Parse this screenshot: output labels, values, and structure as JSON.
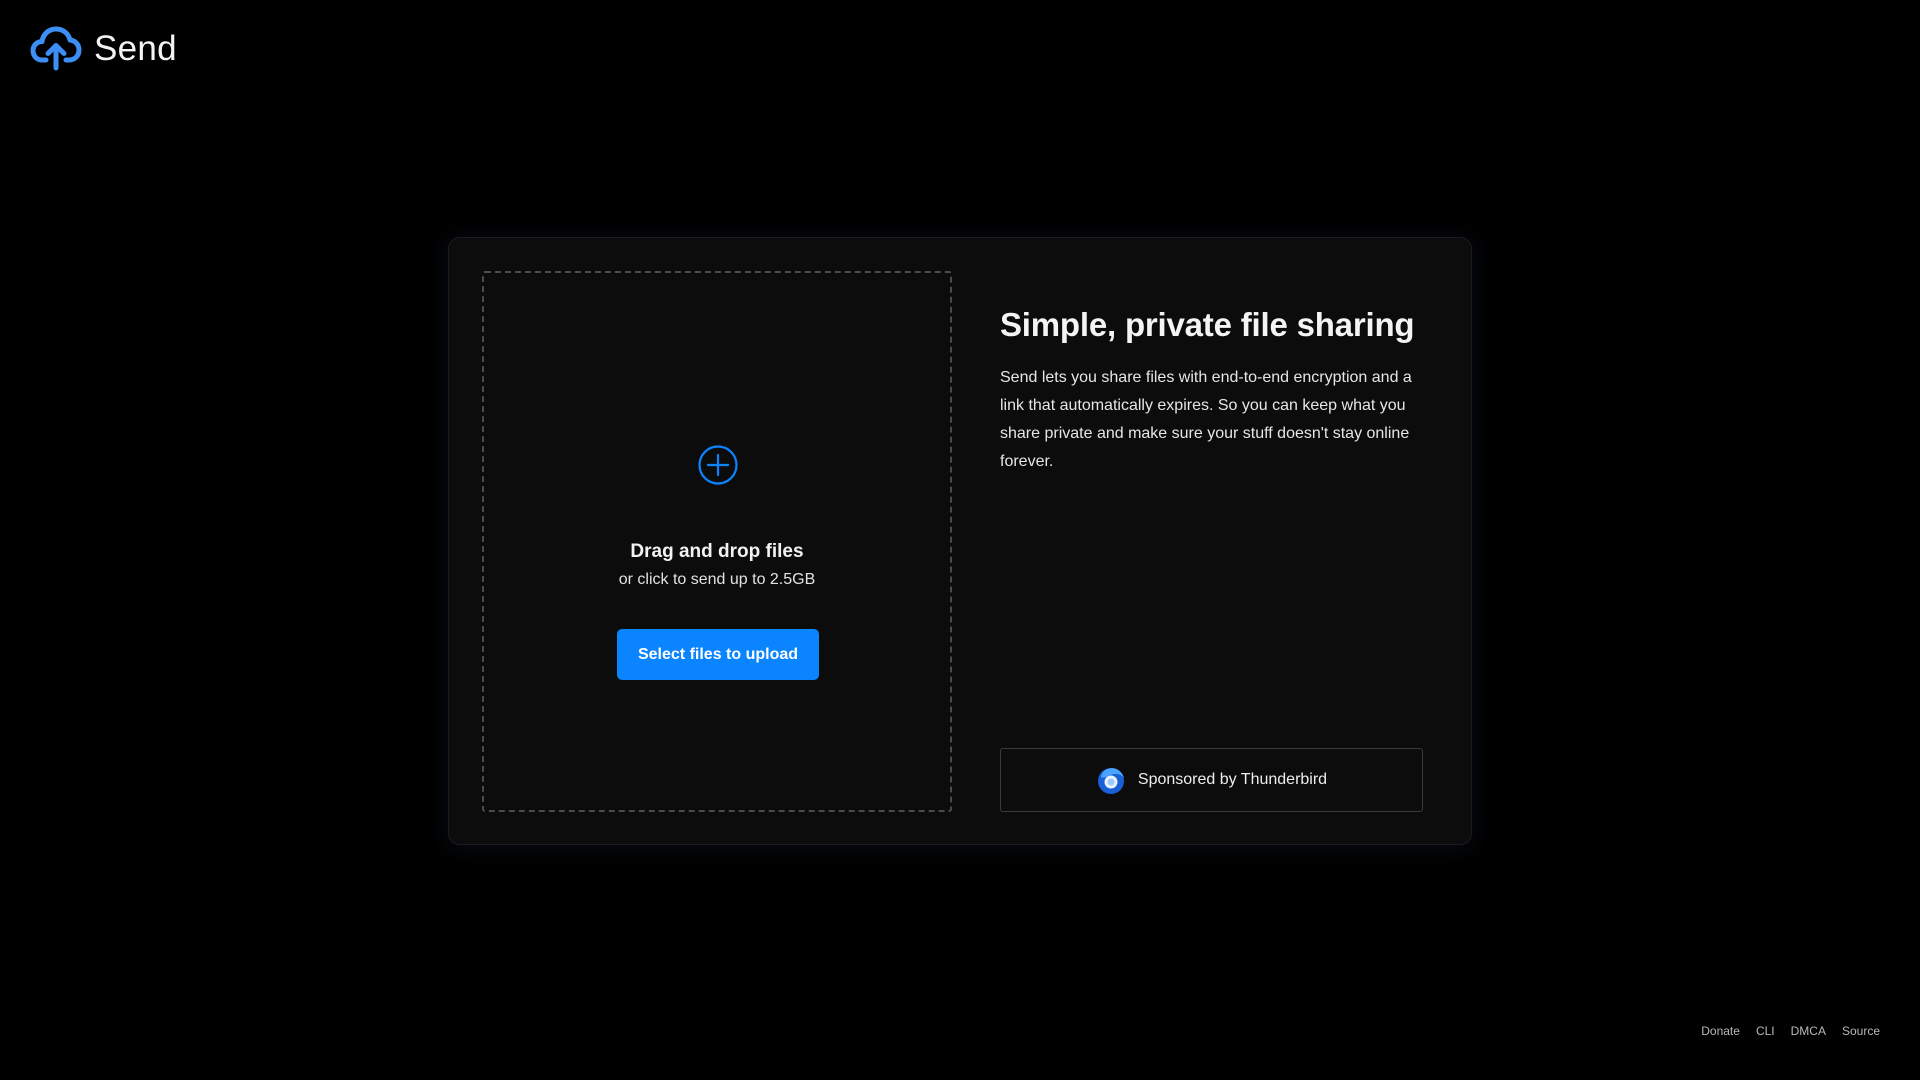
{
  "app": {
    "name": "Send",
    "logo_icon": "cloud-upload-icon"
  },
  "upload": {
    "icon": "plus-circle-icon",
    "title": "Drag and drop files",
    "subtitle": "or click to send up to 2.5GB",
    "button_label": "Select files to upload"
  },
  "info": {
    "title": "Simple, private file sharing",
    "description": "Send lets you share files with end-to-end encryption and a link that automatically expires. So you can keep what you share private and make sure your stuff doesn't stay online forever."
  },
  "sponsor": {
    "icon": "thunderbird-icon",
    "label": "Sponsored by Thunderbird"
  },
  "footer": {
    "links": [
      "Donate",
      "CLI",
      "DMCA",
      "Source"
    ]
  },
  "colors": {
    "background": "#000000",
    "card": "#0c0c0d",
    "accent": "#0a84ff",
    "logo": "#3d8ff5"
  }
}
